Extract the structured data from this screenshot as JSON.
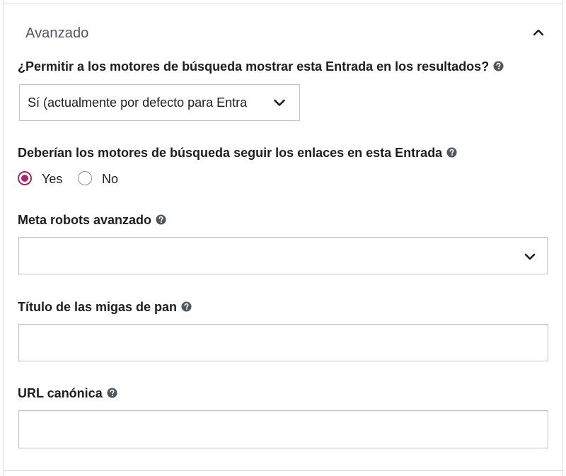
{
  "section": {
    "title": "Avanzado"
  },
  "search_visibility": {
    "label": "¿Permitir a los motores de búsqueda mostrar esta Entrada en los resultados?",
    "selected": "Sí (actualmente por defecto para Entra"
  },
  "follow_links": {
    "label": "Deberían los motores de búsqueda seguir los enlaces en esta Entrada",
    "options": [
      {
        "label": "Yes",
        "checked": true
      },
      {
        "label": "No",
        "checked": false
      }
    ]
  },
  "meta_robots": {
    "label": "Meta robots avanzado",
    "selected": ""
  },
  "breadcrumbs_title": {
    "label": "Título de las migas de pan",
    "value": ""
  },
  "canonical_url": {
    "label": "URL canónica",
    "value": ""
  },
  "colors": {
    "accent": "#a4286a",
    "border": "#c3c4c7",
    "text": "#1e1e1e",
    "muted": "#50575e"
  },
  "icons": {
    "collapse": "chevron-up-icon",
    "dropdown": "chevron-down-icon",
    "help": "question-circle-icon"
  }
}
